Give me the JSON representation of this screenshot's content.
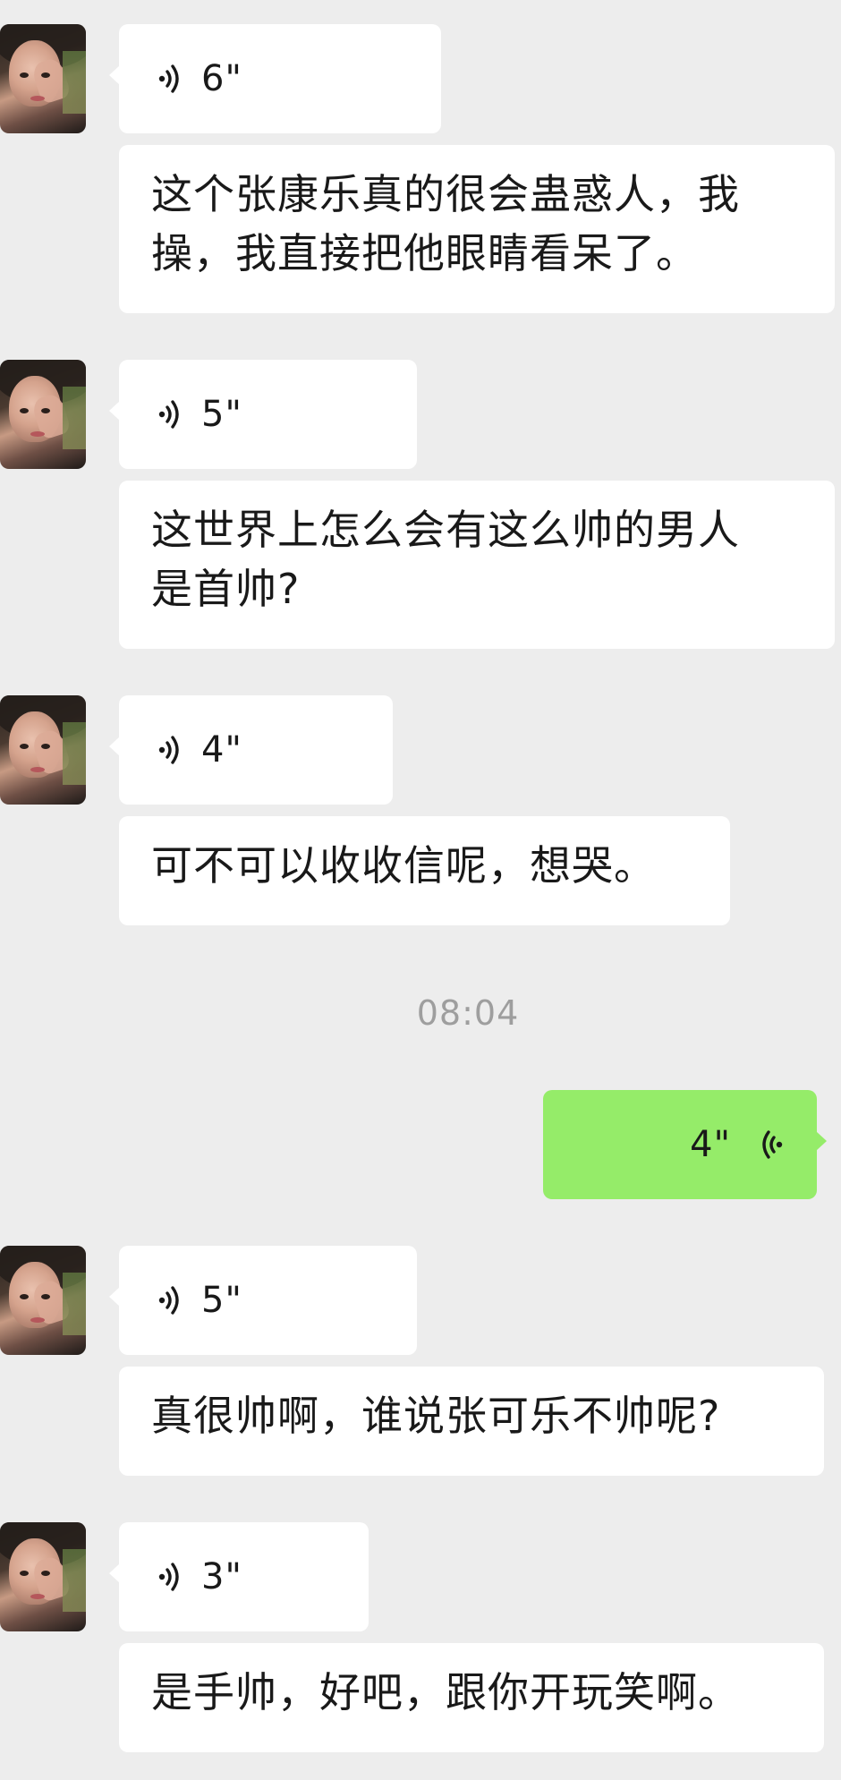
{
  "messages": [
    {
      "type": "voice",
      "side": "left",
      "duration": "6\""
    },
    {
      "type": "text",
      "side": "left",
      "text": "这个张康乐真的很会蛊惑人，我\n操，我直接把他眼睛看呆了。"
    },
    {
      "type": "voice",
      "side": "left",
      "duration": "5\""
    },
    {
      "type": "text",
      "side": "left",
      "text": "这世界上怎么会有这么帅的男人\n是首帅?"
    },
    {
      "type": "voice",
      "side": "left",
      "duration": "4\""
    },
    {
      "type": "text",
      "side": "left",
      "text": "可不可以收收信呢，想哭。"
    },
    {
      "type": "timestamp",
      "text": "08:04"
    },
    {
      "type": "voice",
      "side": "right",
      "duration": "4\""
    },
    {
      "type": "voice",
      "side": "left",
      "duration": "5\""
    },
    {
      "type": "text",
      "side": "left",
      "text": "真很帅啊，谁说张可乐不帅呢?"
    },
    {
      "type": "voice",
      "side": "left",
      "duration": "3\""
    },
    {
      "type": "text",
      "side": "left",
      "text": "是手帅，好吧，跟你开玩笑啊。"
    }
  ],
  "colors": {
    "background": "#ededed",
    "bubble_incoming": "#ffffff",
    "bubble_outgoing": "#95ec69",
    "timestamp": "#9e9e9e"
  },
  "icons": {
    "voice_incoming": "voice-wave-icon",
    "voice_outgoing": "voice-wave-icon"
  }
}
